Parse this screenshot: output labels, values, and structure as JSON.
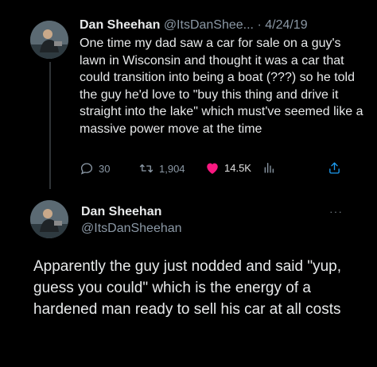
{
  "tweet1": {
    "author_name": "Dan Sheehan",
    "handle": "@ItsDanShee...",
    "separator": " · ",
    "date": "4/24/19",
    "text": "One time my dad saw a car for sale on a guy's lawn in Wisconsin and thought it was a car that could transition into being a boat (???) so he told the guy he'd love to \"buy this thing and drive it straight into the lake\" which must've seemed like a massive power move at the time",
    "replies": "30",
    "retweets": "1,904",
    "likes": "14.5K"
  },
  "tweet2": {
    "author_name": "Dan Sheehan",
    "handle": "@ItsDanSheehan",
    "more": "···",
    "text": "Apparently the guy just nodded and said \"yup, guess you could\" which is the energy of a hardened man ready to sell his car at all costs"
  },
  "icons": {
    "reply": "speech-bubble-icon",
    "retweet": "retweet-icon",
    "like": "heart-icon",
    "analytics": "bar-chart-icon",
    "share": "share-icon"
  },
  "colors": {
    "background": "#000000",
    "like": "#f91880",
    "muted": "#8b98a5"
  }
}
